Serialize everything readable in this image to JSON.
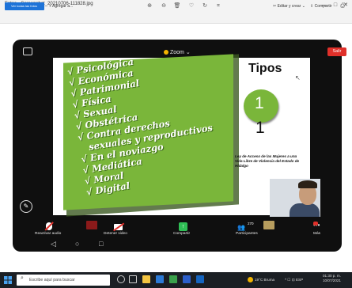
{
  "window": {
    "title": "Fotos - Screenshot_20210706-111828.jpg",
    "controls": [
      "—",
      "□",
      "✕"
    ]
  },
  "toolbar": {
    "view_all_label": "Ver todas las fotos",
    "add_label": "+ Agregar a...",
    "icons": [
      "zoom-in-icon",
      "zoom-out-icon",
      "delete-icon",
      "heart-icon",
      "rotate-icon",
      "crop-icon"
    ],
    "edit_label": "Editar y crear",
    "share_label": "Compartir"
  },
  "meeting": {
    "app_name": "Zoom",
    "exit_label": "Salir",
    "colors": {
      "exit": "#e0302a",
      "share": "#2fbf55",
      "zoom_dot": "#f2b400",
      "slide_green": "#7ab63a"
    }
  },
  "slide": {
    "list": [
      {
        "text": "√ Psicológica",
        "indent": false
      },
      {
        "text": "√ Económica",
        "indent": false
      },
      {
        "text": "√ Patrimonial",
        "indent": false
      },
      {
        "text": "√ Física",
        "indent": false
      },
      {
        "text": "√ Sexual",
        "indent": false
      },
      {
        "text": "√ Obstétrica",
        "indent": false
      },
      {
        "text": "√ Contra derechos",
        "indent": false
      },
      {
        "text": "sexuales y reproductivos",
        "indent": true
      },
      {
        "text": "√ En el noviazgo",
        "indent": false
      },
      {
        "text": "√ Mediática",
        "indent": false
      },
      {
        "text": "√ Moral",
        "indent": false
      },
      {
        "text": "√ Digital",
        "indent": false
      }
    ],
    "heading": "Tipos",
    "circle_number": "1",
    "big_number": "1",
    "law_text": "Ley de Acceso de las Mujeres a una Vida Libre de Violencia del Estado de Hidalgo"
  },
  "controls": {
    "audio": "Reactivar audio",
    "video": "Detener video",
    "share": "Compartir",
    "participants": "Participantes",
    "participants_count": "270",
    "more": "Más"
  },
  "taskbar": {
    "search_placeholder": "Escribe aquí para buscar",
    "weather": "19°C Bruma",
    "tray": "^ ☐ ⊡ ESP",
    "time": "01:30 p. m.",
    "date": "10/07/2021"
  }
}
